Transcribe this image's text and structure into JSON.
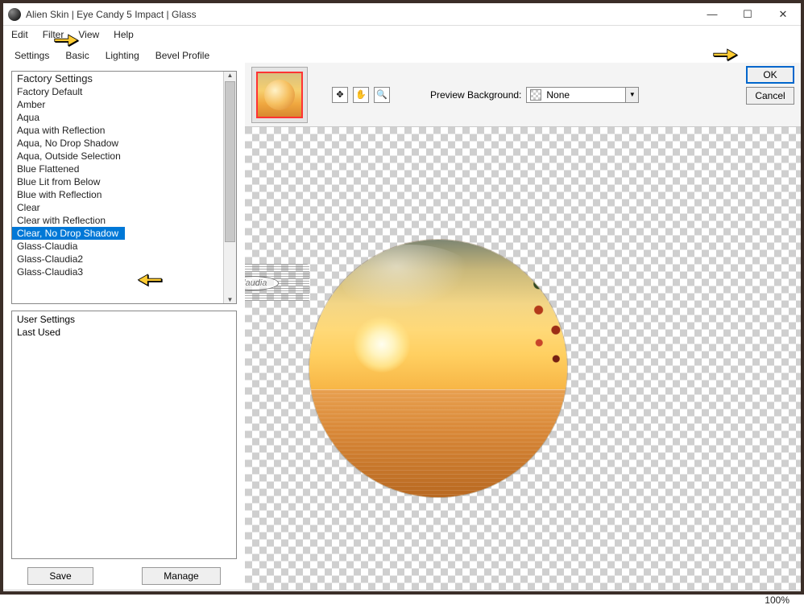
{
  "window": {
    "title": "Alien Skin | Eye Candy 5 Impact | Glass"
  },
  "win_buttons": {
    "min": "—",
    "max": "☐",
    "close": "✕"
  },
  "menu": {
    "edit": "Edit",
    "filter": "Filter",
    "view": "View",
    "help": "Help"
  },
  "tabs": {
    "settings": "Settings",
    "basic": "Basic",
    "lighting": "Lighting",
    "bevel": "Bevel Profile"
  },
  "factory": {
    "header": "Factory Settings",
    "items": [
      "Factory Default",
      "Amber",
      "Aqua",
      "Aqua with Reflection",
      "Aqua, No Drop Shadow",
      "Aqua, Outside Selection",
      "Blue Flattened",
      "Blue Lit from Below",
      "Blue with Reflection",
      "Clear",
      "Clear with Reflection",
      "Clear, No Drop Shadow",
      "Glass-Claudia",
      "Glass-Claudia2",
      "Glass-Claudia3"
    ],
    "selected_index": 11
  },
  "user": {
    "header": "User Settings",
    "items": [
      "Last Used"
    ]
  },
  "buttons": {
    "save": "Save",
    "manage": "Manage",
    "ok": "OK",
    "cancel": "Cancel"
  },
  "preview": {
    "bg_label": "Preview Background:",
    "bg_value": "None",
    "zoom": "100%"
  },
  "stamp": {
    "text": "claudia"
  },
  "tool_icons": {
    "move": "✥",
    "hand": "✋",
    "zoom": "🔍"
  }
}
